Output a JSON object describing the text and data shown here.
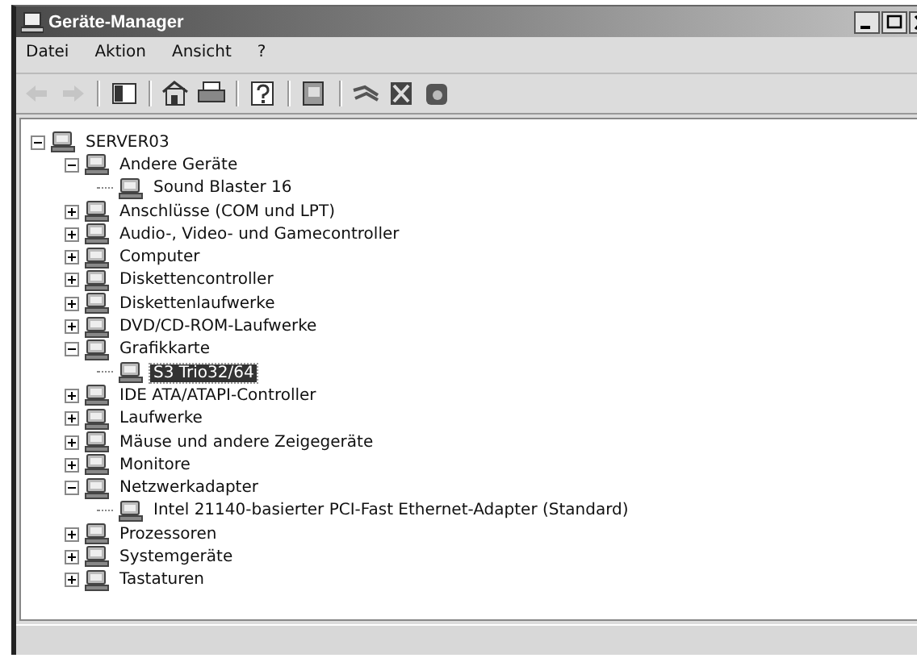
{
  "window": {
    "title": "Geräte-Manager"
  },
  "menu": [
    "Datei",
    "Aktion",
    "Ansicht",
    "?"
  ],
  "toolbar": [
    {
      "kind": "back",
      "disabled": true
    },
    {
      "kind": "forward",
      "disabled": true
    },
    {
      "kind": "separator"
    },
    {
      "kind": "panel",
      "disabled": false
    },
    {
      "kind": "separator"
    },
    {
      "kind": "properties",
      "disabled": false
    },
    {
      "kind": "print",
      "disabled": false
    },
    {
      "kind": "separator"
    },
    {
      "kind": "help",
      "disabled": false
    },
    {
      "kind": "separator"
    },
    {
      "kind": "scan",
      "disabled": false
    },
    {
      "kind": "separator"
    },
    {
      "kind": "update",
      "disabled": false
    },
    {
      "kind": "uninstall",
      "disabled": false
    },
    {
      "kind": "disable",
      "disabled": false
    }
  ],
  "tree": {
    "label": "SERVER03",
    "expanded": true,
    "selected": false,
    "children": [
      {
        "label": "Andere Geräte",
        "expanded": true,
        "selected": false,
        "children": [
          {
            "label": "Sound Blaster 16",
            "selected": false
          }
        ]
      },
      {
        "label": "Anschlüsse (COM und LPT)",
        "expanded": false,
        "selected": false
      },
      {
        "label": "Audio-, Video- und Gamecontroller",
        "expanded": false,
        "selected": false
      },
      {
        "label": "Computer",
        "expanded": false,
        "selected": false
      },
      {
        "label": "Diskettencontroller",
        "expanded": false,
        "selected": false
      },
      {
        "label": "Diskettenlaufwerke",
        "expanded": false,
        "selected": false
      },
      {
        "label": "DVD/CD-ROM-Laufwerke",
        "expanded": false,
        "selected": false
      },
      {
        "label": "Grafikkarte",
        "expanded": true,
        "selected": false,
        "children": [
          {
            "label": "S3 Trio32/64",
            "selected": true
          }
        ]
      },
      {
        "label": "IDE ATA/ATAPI-Controller",
        "expanded": false,
        "selected": false
      },
      {
        "label": "Laufwerke",
        "expanded": false,
        "selected": false
      },
      {
        "label": "Mäuse und andere Zeigegeräte",
        "expanded": false,
        "selected": false
      },
      {
        "label": "Monitore",
        "expanded": false,
        "selected": false
      },
      {
        "label": "Netzwerkadapter",
        "expanded": true,
        "selected": false,
        "children": [
          {
            "label": "Intel 21140-basierter PCI-Fast Ethernet-Adapter (Standard)",
            "selected": false
          }
        ]
      },
      {
        "label": "Prozessoren",
        "expanded": false,
        "selected": false
      },
      {
        "label": "Systemgeräte",
        "expanded": false,
        "selected": false
      },
      {
        "label": "Tastaturen",
        "expanded": false,
        "selected": false
      }
    ]
  }
}
